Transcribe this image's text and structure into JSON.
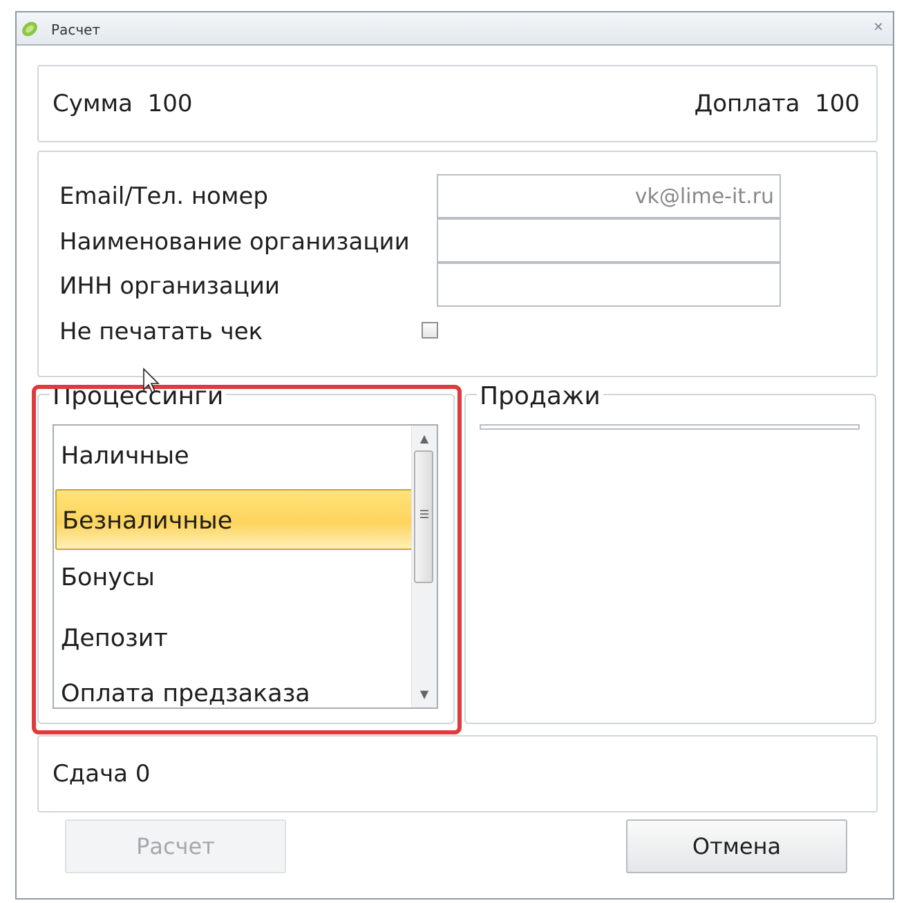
{
  "window": {
    "title": "Расчет"
  },
  "totals": {
    "sum_label": "Сумма",
    "sum_value": "100",
    "surcharge_label": "Доплата",
    "surcharge_value": "100"
  },
  "form": {
    "email_label": "Email/Тел. номер",
    "email_value": "vk@lime-it.ru",
    "org_name_label": "Наименование организации",
    "org_name_value": "",
    "inn_label": "ИНН организации",
    "inn_value": "",
    "no_print_label": "Не печатать чек",
    "no_print_checked": false
  },
  "processing": {
    "title": "Процессинги",
    "items": [
      "Наличные",
      "Безналичные",
      "Бонусы",
      "Депозит",
      "Оплата предзаказа"
    ],
    "selected_index": 1
  },
  "sales": {
    "title": "Продажи"
  },
  "change": {
    "label": "Сдача",
    "value": "0"
  },
  "buttons": {
    "calc": "Расчет",
    "cancel": "Отмена"
  },
  "colors": {
    "selection": "#fdd35c",
    "highlight_frame": "#e03a3e"
  }
}
